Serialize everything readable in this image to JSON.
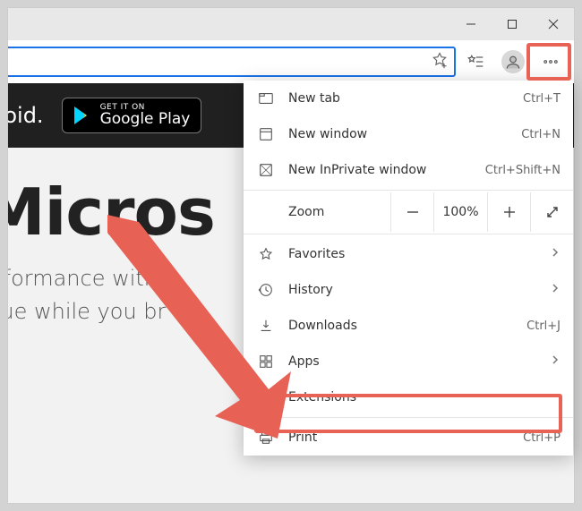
{
  "window_controls": {
    "minimize_name": "minimize",
    "maximize_name": "maximize",
    "close_name": "close"
  },
  "toolbar": {
    "addressbar_value": "",
    "star_add_name": "add-favorite",
    "favorites_list_name": "favorites-bar",
    "profile_name": "profile",
    "more_name": "settings-and-more"
  },
  "googleplay": {
    "prefix_text": "roid.",
    "small": "GET IT ON",
    "big": "Google Play"
  },
  "hero": {
    "h1": "Micros",
    "line1": "erformance with r",
    "line2": "alue while you br"
  },
  "menu": {
    "new_tab": {
      "label": "New tab",
      "shortcut": "Ctrl+T"
    },
    "new_window": {
      "label": "New window",
      "shortcut": "Ctrl+N"
    },
    "new_inprivate": {
      "label": "New InPrivate window",
      "shortcut": "Ctrl+Shift+N"
    },
    "zoom": {
      "label": "Zoom",
      "value": "100%"
    },
    "favorites": {
      "label": "Favorites"
    },
    "history": {
      "label": "History"
    },
    "downloads": {
      "label": "Downloads",
      "shortcut": "Ctrl+J"
    },
    "apps": {
      "label": "Apps"
    },
    "extensions": {
      "label": "Extensions"
    },
    "print": {
      "label": "Print",
      "shortcut": "Ctrl+P"
    }
  },
  "highlight": {
    "more": "red-highlight-more-button",
    "extensions": "red-highlight-extensions"
  }
}
